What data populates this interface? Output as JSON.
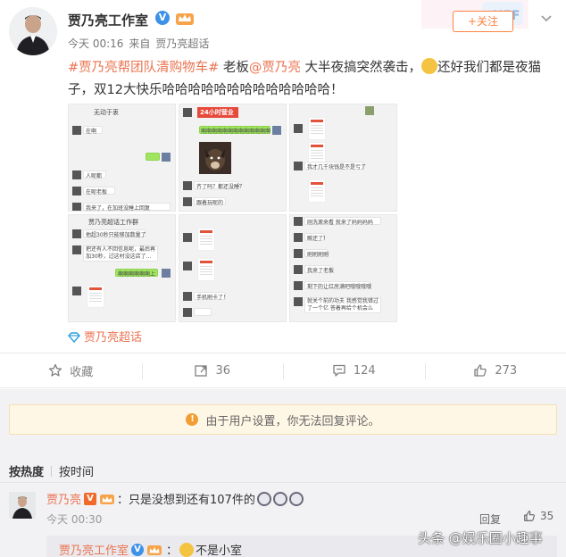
{
  "post": {
    "author": "贾乃亮工作室",
    "verified_badge": "V",
    "time": "今天 00:16",
    "source_prefix": "来自",
    "source": "贾乃亮超话",
    "follow_label": "+关注",
    "text": {
      "tag": "#贾乃亮帮团队清购物车#",
      "before_mention": " 老板",
      "mention": "@贾乃亮",
      "after_mention": " 大半夜搞突然袭击，",
      "after_emoji": "还好我们都是夜猫子，双12大快乐哈哈哈哈哈哈哈哈哈哈哈哈哈！"
    },
    "images": {
      "img1_title": "无动于衷",
      "img1_c1": "在啊",
      "img1_c2": "人呢都",
      "img1_c3": "在呢老板",
      "img1_c4": "我来了，在加班没睡上回复",
      "img2_title": "24小时营业",
      "img2_c1": "啊啊啊啊啊啊啊啊啊啊啊啊啊",
      "img2_c2": "齐了吗？都还没睡？",
      "img2_c3": "跟着玩呢的",
      "img3_c1": "我才几千块钱是不是亏了",
      "img4_title": "贾乃亮超话工作群",
      "img4_c1": "他超30秒只能够加数量了",
      "img4_c2": "把还有人不回信息呢，最后再加30秒，过这村没这店了…",
      "img4_c3": "啊啊啊啊啊啊上",
      "img5_c1": "手机刷卡了！",
      "img6_c1": "刚洗漱来看 就来了妈妈妈妈",
      "img6_c2": "瞬还了！",
      "img6_c3": "刷刷刷刷",
      "img6_c4": "我来了老板",
      "img6_c5": "剩下的让红房满吧哦哦哦哦",
      "img6_c6": "就关个前的功夫 我感觉我错过了一个亿 答着再给个机会么"
    },
    "supertopic": "贾乃亮超话"
  },
  "actions": {
    "favorite_label": "收藏",
    "repost_count": "36",
    "comment_count": "124",
    "like_count": "273"
  },
  "notice": "由于用户设置，你无法回复评论。",
  "sort": {
    "hot": "按热度",
    "time": "按时间"
  },
  "comment": {
    "name": "贾乃亮",
    "badge": "V",
    "text": "：只是没想到还有107件的",
    "time": "今天 00:30",
    "reply_label": "回复",
    "like_count": "35"
  },
  "sub_reply": {
    "name": "贾乃亮工作室",
    "badge": "V",
    "text": "不是小室"
  },
  "watermark": "头条 @娱乐圈小趣事",
  "colors": {
    "link_orange": "#eb7350",
    "verified_blue": "#3d91e6",
    "follow_orange": "#ff8140",
    "notice_bg": "#fff7e6",
    "page_grey": "#f2f2f5"
  },
  "icons": [
    "star-icon",
    "repost-icon",
    "comment-icon",
    "like-icon",
    "warning-icon",
    "supertopic-icon",
    "chevron-down-icon",
    "crown-icon"
  ]
}
